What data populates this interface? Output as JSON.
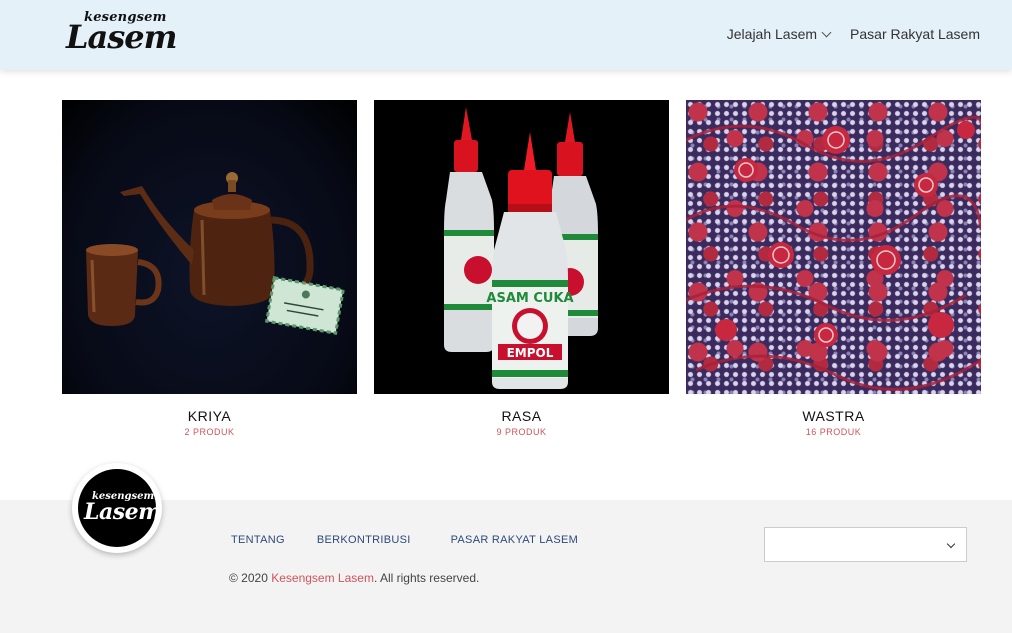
{
  "header": {
    "logo": {
      "small": "kesengsem",
      "big": "Lasem"
    },
    "nav": [
      {
        "label": "Jelajah Lasem"
      },
      {
        "label": "Pasar Rakyat Lasem"
      }
    ]
  },
  "products": [
    {
      "title": "KRIYA",
      "count": "2 PRODUK"
    },
    {
      "title": "RASA",
      "count": "9 PRODUK"
    },
    {
      "title": "WASTRA",
      "count": "16 PRODUK"
    }
  ],
  "footer": {
    "logo": {
      "small": "kesengsem",
      "big": "Lasem"
    },
    "links": [
      {
        "label": "TENTANG"
      },
      {
        "label": "BERKONTRIBUSI"
      },
      {
        "label": "PASAR RAKYAT LASEM"
      }
    ],
    "copyright_prefix": "© 2020 ",
    "copyright_brand": "Kesengsem Lasem",
    "copyright_suffix": ". All rights reserved.",
    "select_value": ""
  },
  "colors": {
    "header_bg": "#e4f1f8",
    "accent": "#d0545b",
    "link": "#2d4a78",
    "footer_bg": "#f3f3f3"
  }
}
